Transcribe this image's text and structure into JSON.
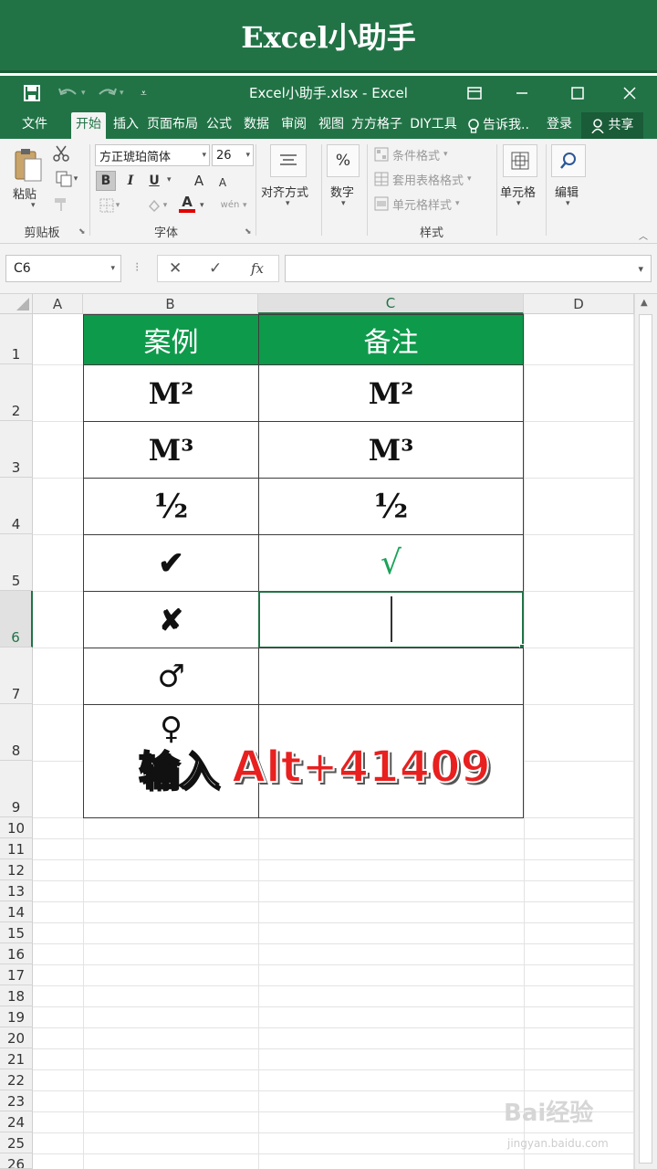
{
  "banner": {
    "title": "Excel小助手"
  },
  "window": {
    "doc_title": "Excel小助手.xlsx - Excel",
    "icons": [
      "save-icon",
      "undo-icon",
      "redo-icon",
      "customize-icon",
      "ribbon-display-icon",
      "minimize-icon",
      "maximize-icon",
      "close-icon"
    ]
  },
  "tabs": [
    {
      "label": "文件"
    },
    {
      "label": "开始"
    },
    {
      "label": "插入"
    },
    {
      "label": "页面布局"
    },
    {
      "label": "公式"
    },
    {
      "label": "数据"
    },
    {
      "label": "审阅"
    },
    {
      "label": "视图"
    },
    {
      "label": "方方格子"
    },
    {
      "label": "DIY工具"
    }
  ],
  "tellme": "告诉我..",
  "login": "登录",
  "share": "共享",
  "ribbon": {
    "paste": "粘贴",
    "clipboard": "剪贴板",
    "font_name": "方正琥珀简体",
    "font_size": "26",
    "bold": "B",
    "italic": "I",
    "underline": "U",
    "grow_font": "A",
    "shrink_font": "A",
    "font_color": "A",
    "wen": "wén",
    "font_group": "字体",
    "align": "对齐方式",
    "number": "数字",
    "percent": "%",
    "cond_format": "条件格式",
    "table_format": "套用表格格式",
    "cell_style": "单元格样式",
    "styles": "样式",
    "cells": "单元格",
    "edit": "编辑"
  },
  "formula": {
    "name_box": "C6",
    "fx": "fx",
    "cancel": "✕",
    "enter": "✓",
    "value": ""
  },
  "columns": [
    "A",
    "B",
    "C",
    "D"
  ],
  "rows": [
    "1",
    "2",
    "3",
    "4",
    "5",
    "6",
    "7",
    "8",
    "9",
    "10",
    "11",
    "12",
    "13",
    "14",
    "15",
    "16",
    "17",
    "18",
    "19",
    "20",
    "21",
    "22",
    "23",
    "24",
    "25",
    "26"
  ],
  "table": {
    "header_b": "案例",
    "header_c": "备注",
    "body": [
      {
        "b": "M²",
        "c": "M²"
      },
      {
        "b": "M³",
        "c": "M³"
      },
      {
        "b": "½",
        "c": "½"
      },
      {
        "b": "✔",
        "c": "√"
      },
      {
        "b": "✘",
        "c": ""
      },
      {
        "b": "♂",
        "c": ""
      },
      {
        "b": "♀",
        "c": ""
      }
    ]
  },
  "overlay": {
    "prefix": "输入",
    "shortcut": "Alt+41409"
  },
  "watermark": {
    "logo": "Bai经验",
    "url": "jingyan.baidu.com"
  },
  "colors": {
    "excel_green": "#217346",
    "header_fill": "#0e9a4b",
    "check_green": "#1aa35a",
    "overlay_red": "#e8201f"
  }
}
